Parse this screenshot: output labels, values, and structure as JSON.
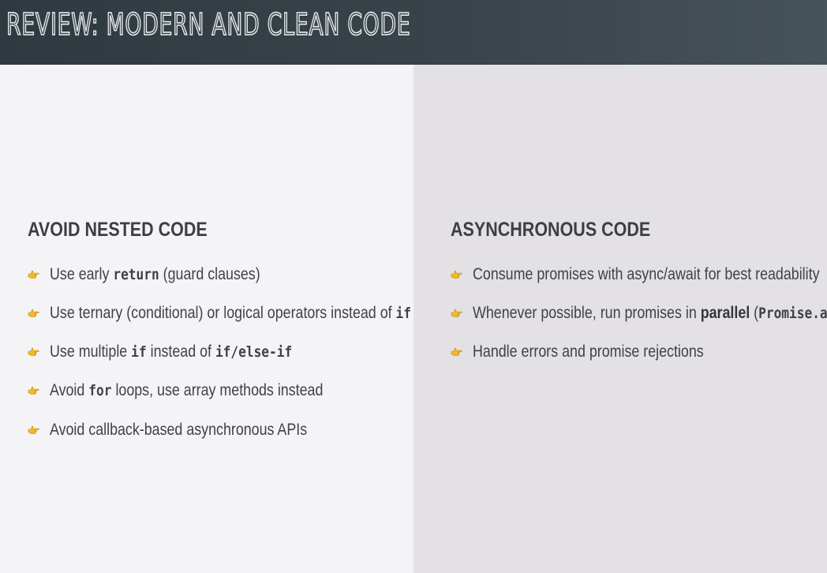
{
  "header": {
    "title": "REVIEW: MODERN AND CLEAN CODE"
  },
  "left": {
    "heading": "AVOID NESTED CODE",
    "items": [
      {
        "t1": "Use early ",
        "c1": "return",
        "t2": " (guard clauses)"
      },
      {
        "t1": "Use ternary (conditional) or logical operators instead of ",
        "c1": "if"
      },
      {
        "t1": "Use multiple ",
        "c1": "if",
        "t2": " instead of ",
        "c2": "if/else-if"
      },
      {
        "t1": "Avoid ",
        "c1": "for",
        "t2": " loops, use array methods instead"
      },
      {
        "t1": "Avoid callback-based asynchronous APIs"
      }
    ]
  },
  "right": {
    "heading": "ASYNCHRONOUS CODE",
    "items": [
      {
        "t1": "Consume promises with async/await for best readability"
      },
      {
        "t1": "Whenever possible, run promises in ",
        "b1": "parallel",
        "t2": " (",
        "c1": "Promise.all",
        "t3": ")"
      },
      {
        "t1": "Handle errors and promise rejections"
      }
    ]
  },
  "colors": {
    "header_bg": "#39444a",
    "left_bg": "#f4f4f6",
    "right_bg": "#e3e1e4",
    "text": "#3e4247",
    "bullet": "#f2b92c"
  },
  "icons": {
    "bullet": "pointing-hand-icon"
  }
}
